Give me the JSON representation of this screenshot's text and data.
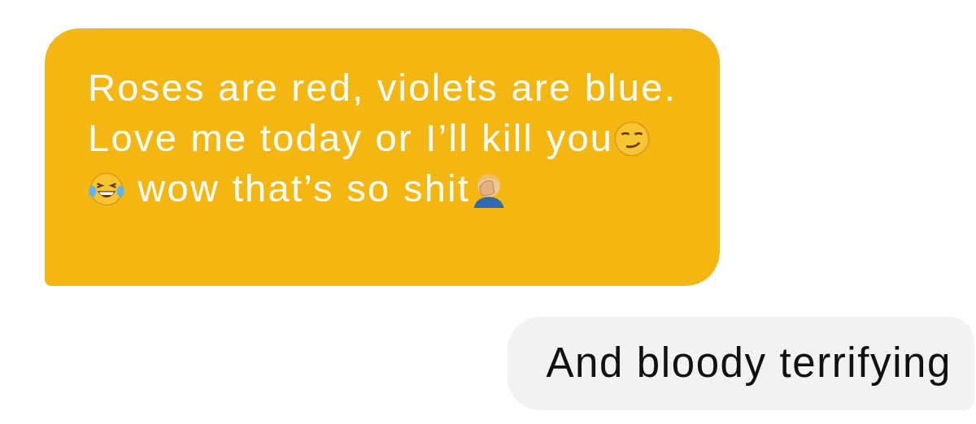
{
  "messages": [
    {
      "outgoing": false,
      "parts": [
        {
          "kind": "text",
          "text": "Roses are red, violets are blue. Love me today or I’ll kill you"
        },
        {
          "kind": "smirk"
        },
        {
          "kind": "laugh"
        },
        {
          "kind": "text",
          "text": " wow that’s so shit"
        },
        {
          "kind": "facepalm"
        }
      ]
    },
    {
      "outgoing": true,
      "parts": [
        {
          "kind": "text",
          "text": "And bloody terrifying"
        }
      ]
    }
  ]
}
